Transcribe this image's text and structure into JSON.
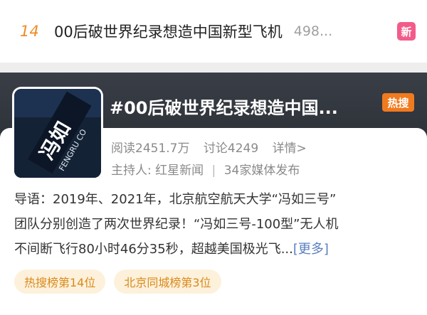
{
  "rank_item": {
    "rank": "14",
    "title": "00后破世界纪录想造中国新型飞机",
    "count": "498...",
    "badge": "新"
  },
  "topic": {
    "title": "#00后破世界纪录想造中国...",
    "badge": "热搜",
    "stats": {
      "reads": "阅读2451.7万",
      "discussions": "讨论4249",
      "details": "详情>"
    },
    "host_label": "主持人:",
    "host_name": "红星新闻",
    "sep": "|",
    "media": "34家媒体发布",
    "intro_lines": [
      "导语：2019年、2021年，北京航空航天大学“冯如三号”",
      "团队分别创造了两次世界纪录！“冯如三号-100型”无人机",
      "不间断飞行80小时46分35秒，超越美国极光飞..."
    ],
    "more": "[更多]",
    "tags": [
      "热搜榜第14位",
      "北京同城榜第3位"
    ],
    "thumb_text": [
      "冯如",
      "FENGRU CO"
    ]
  },
  "colors": {
    "rank_orange": "#f08a24",
    "new_badge": "#f25c8a",
    "hot_badge": "#f07a1e",
    "link_blue": "#5a7fbf",
    "tag_bg": "#fdf1dc",
    "tag_text": "#d98a1a"
  }
}
